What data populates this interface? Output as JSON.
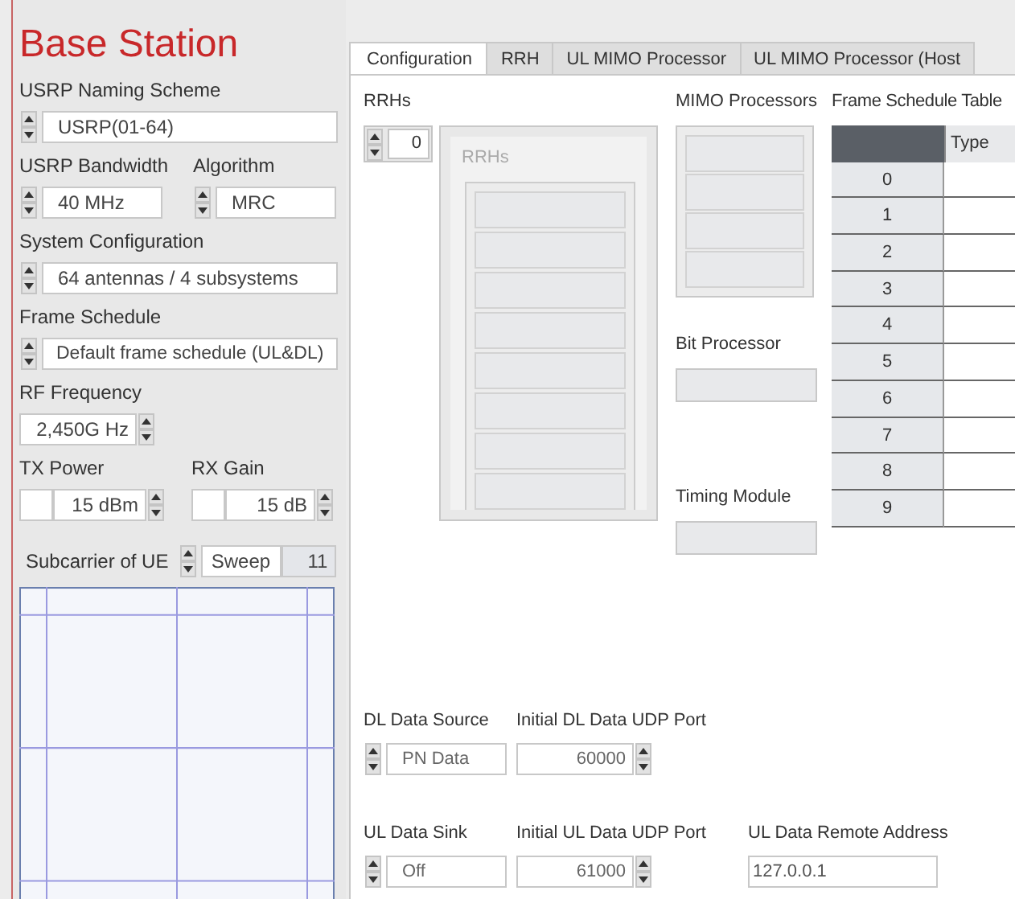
{
  "sidebar": {
    "title": "Base Station",
    "naming": {
      "label": "USRP Naming Scheme",
      "value": "USRP(01-64)"
    },
    "bandwidth": {
      "label": "USRP Bandwidth",
      "value": "40 MHz"
    },
    "algorithm": {
      "label": "Algorithm",
      "value": "MRC"
    },
    "system": {
      "label": "System Configuration",
      "value": "64 antennas / 4 subsystems"
    },
    "frame": {
      "label": "Frame Schedule",
      "value": "Default frame schedule (UL&DL)"
    },
    "rf": {
      "label": "RF Frequency",
      "value": "2,450G Hz"
    },
    "tx": {
      "label": "TX Power",
      "value": "15 dBm"
    },
    "rx": {
      "label": "RX Gain",
      "value": "15 dB"
    },
    "subcarrier": {
      "label": "Subcarrier of UE",
      "mode": "Sweep",
      "value": "11"
    }
  },
  "tabs": [
    {
      "label": "Configuration",
      "selected": true
    },
    {
      "label": "RRH",
      "selected": false
    },
    {
      "label": "UL MIMO Processor",
      "selected": false
    },
    {
      "label": "UL MIMO Processor (Host",
      "selected": false
    }
  ],
  "rrhs": {
    "label": "RRHs",
    "value": "0",
    "box_label": "RRHs"
  },
  "mimo": {
    "label": "MIMO Processors"
  },
  "bit": {
    "label": "Bit Processor"
  },
  "timing": {
    "label": "Timing Module"
  },
  "table": {
    "title": "Frame Schedule Table",
    "header": "Type",
    "rows": [
      "0",
      "1",
      "2",
      "3",
      "4",
      "5",
      "6",
      "7",
      "8",
      "9"
    ]
  },
  "dl_source": {
    "label": "DL Data Source",
    "value": "PN Data"
  },
  "dl_port": {
    "label": "Initial DL Data UDP Port",
    "value": "60000"
  },
  "ul_sink": {
    "label": "UL Data Sink",
    "value": "Off"
  },
  "ul_port": {
    "label": "Initial UL Data UDP Port",
    "value": "61000"
  },
  "ul_address": {
    "label": "UL Data Remote Address",
    "value": "127.0.0.1"
  }
}
